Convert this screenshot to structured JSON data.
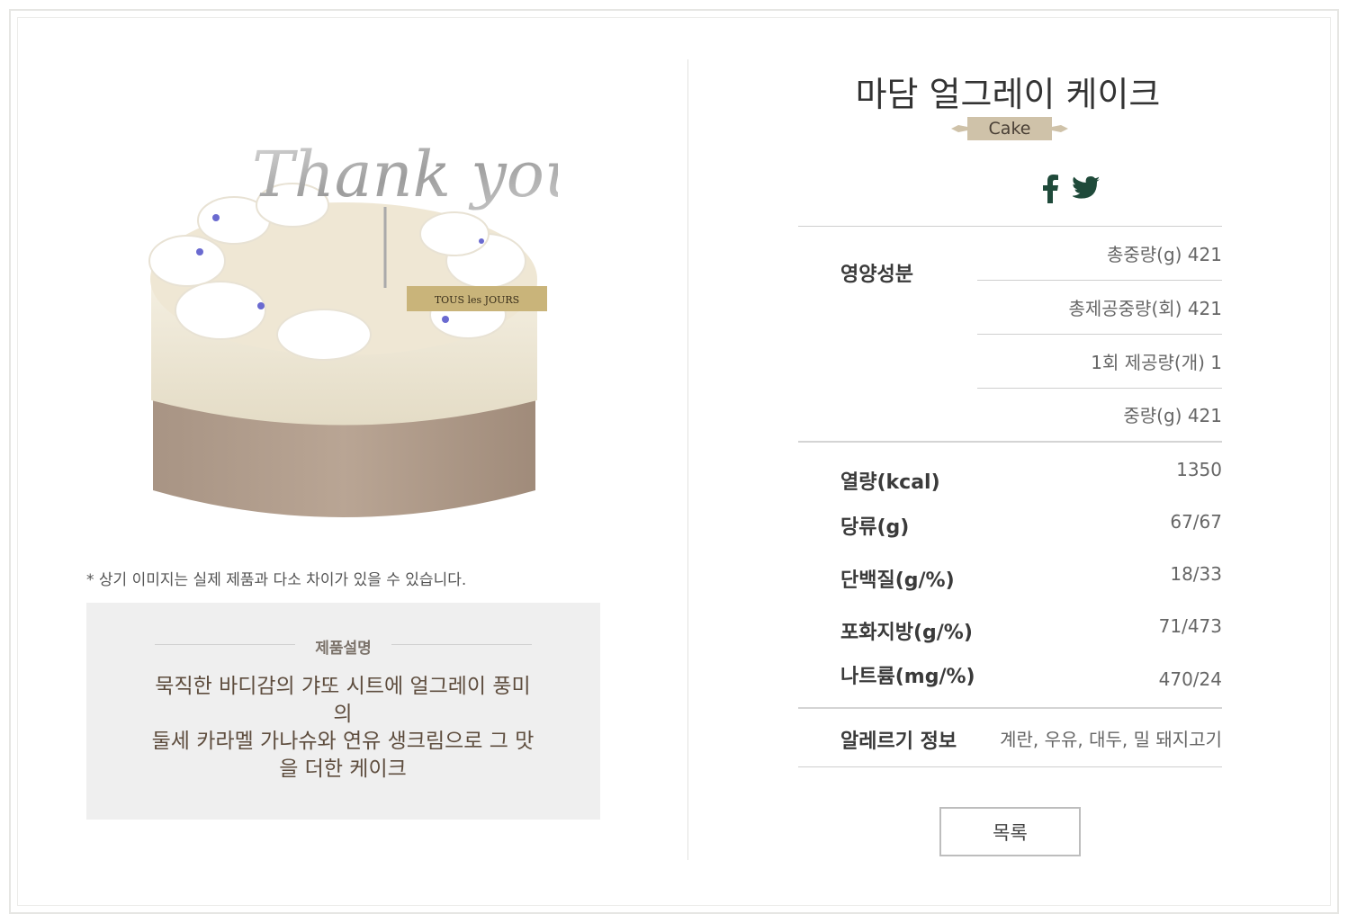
{
  "product": {
    "name": "마담 얼그레이 케이크",
    "category": "Cake",
    "image": {
      "topper_text": "Thank you",
      "brand_text": "TOUS les JOURS"
    }
  },
  "share": {
    "icons": [
      "facebook-icon",
      "twitter-icon"
    ]
  },
  "disclaimer": "* 상기 이미지는 실제 제품과 다소 차이가 있을 수 있습니다.",
  "description": {
    "heading": "제품설명",
    "lines": [
      "묵직한 바디감의 갸또 시트에 얼그레이 풍미",
      "의",
      "둘세 카라멜 가나슈와 연유 생크림으로 그 맛",
      "을 더한 케이크"
    ]
  },
  "nutrition": {
    "heading": "영양성분",
    "serving": [
      "총중량(g) 421",
      "총제공중량(회) 421",
      "1회 제공량(개) 1",
      "중량(g) 421"
    ],
    "facts": [
      {
        "label": "열량(kcal)",
        "value": "1350"
      },
      {
        "label": "당류(g)",
        "value": "67/67"
      },
      {
        "label": "단백질(g/%)",
        "value": "18/33"
      },
      {
        "label": "포화지방(g/%)",
        "value": "71/473"
      },
      {
        "label": "나트륨(mg/%)",
        "value": "470/24"
      }
    ],
    "allergy": {
      "label": "알레르기 정보",
      "value": "계란, 우유, 대두, 밀 돼지고기"
    }
  },
  "actions": {
    "list_label": "목록"
  },
  "colors": {
    "ribbon": "#cfc2a9",
    "sns": "#1f4a3a",
    "box_bg": "#efefef"
  }
}
